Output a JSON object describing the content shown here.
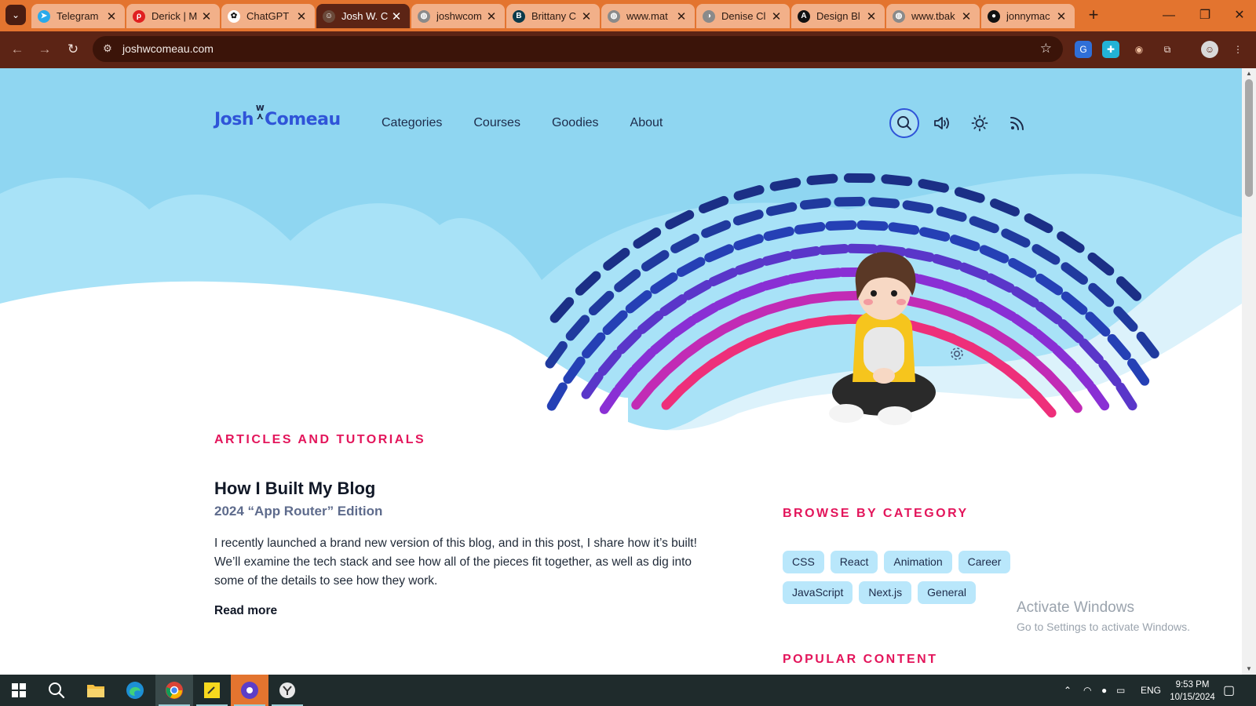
{
  "browser": {
    "tabs": [
      {
        "label": "Telegram",
        "icon": "telegram-icon",
        "color": "#29a9eb",
        "glyph": "➤"
      },
      {
        "label": "Derick | M",
        "icon": "pdf-icon",
        "color": "#e02020",
        "glyph": "ρ"
      },
      {
        "label": "ChatGPT",
        "icon": "chatgpt-icon",
        "color": "#ffffff",
        "glyph": "✿"
      },
      {
        "label": "Josh W. C",
        "icon": "josh-avatar-icon",
        "color": "#6b4a3a",
        "glyph": "☺"
      },
      {
        "label": "joshwcom",
        "icon": "globe-icon",
        "color": "#8a8a8a",
        "glyph": "◍"
      },
      {
        "label": "Brittany C",
        "icon": "behance-icon",
        "color": "#0b3a4a",
        "glyph": "B"
      },
      {
        "label": "www.mat",
        "icon": "globe-icon",
        "color": "#8a8a8a",
        "glyph": "◍"
      },
      {
        "label": "Denise Cl",
        "icon": "profile-icon",
        "color": "#8a8a8a",
        "glyph": "◑"
      },
      {
        "label": "Design Bl",
        "icon": "design-icon",
        "color": "#111111",
        "glyph": "A"
      },
      {
        "label": "www.tbak",
        "icon": "globe-icon",
        "color": "#8a8a8a",
        "glyph": "◍"
      },
      {
        "label": "jonnymac",
        "icon": "github-icon",
        "color": "#111111",
        "glyph": "●"
      }
    ],
    "active_tab": 3,
    "url": "joshwcomeau.com"
  },
  "site": {
    "logo_first": "Josh",
    "logo_sep": "w",
    "logo_last": "Comeau",
    "nav": [
      "Categories",
      "Courses",
      "Goodies",
      "About"
    ],
    "icons": [
      "search-icon",
      "sound-icon",
      "theme-toggle-icon",
      "rss-icon"
    ]
  },
  "content": {
    "section_label": "ARTICLES AND TUTORIALS",
    "post": {
      "title": "How I Built My Blog",
      "subtitle": "2024 “App Router” Edition",
      "excerpt": "I recently launched a brand new version of this blog, and in this post, I share how it’s built! We’ll examine the tech stack and see how all of the pieces fit together, as well as dig into some of the details to see how they work.",
      "read_more": "Read more"
    },
    "sidebar": {
      "browse_label": "BROWSE BY CATEGORY",
      "categories": [
        "CSS",
        "React",
        "Animation",
        "Career",
        "JavaScript",
        "Next.js",
        "General"
      ],
      "popular_label": "POPULAR CONTENT"
    }
  },
  "watermark": {
    "line1": "Activate Windows",
    "line2": "Go to Settings to activate Windows."
  },
  "taskbar": {
    "language": "ENG",
    "time": "9:53 PM",
    "date": "10/15/2024"
  },
  "colors": {
    "accent_pink": "#e3155b",
    "brand_blue": "#2f54d8",
    "sky": "#8fd6f1",
    "chip_bg": "#b9e7fb",
    "browser_frame": "#e3742f"
  }
}
